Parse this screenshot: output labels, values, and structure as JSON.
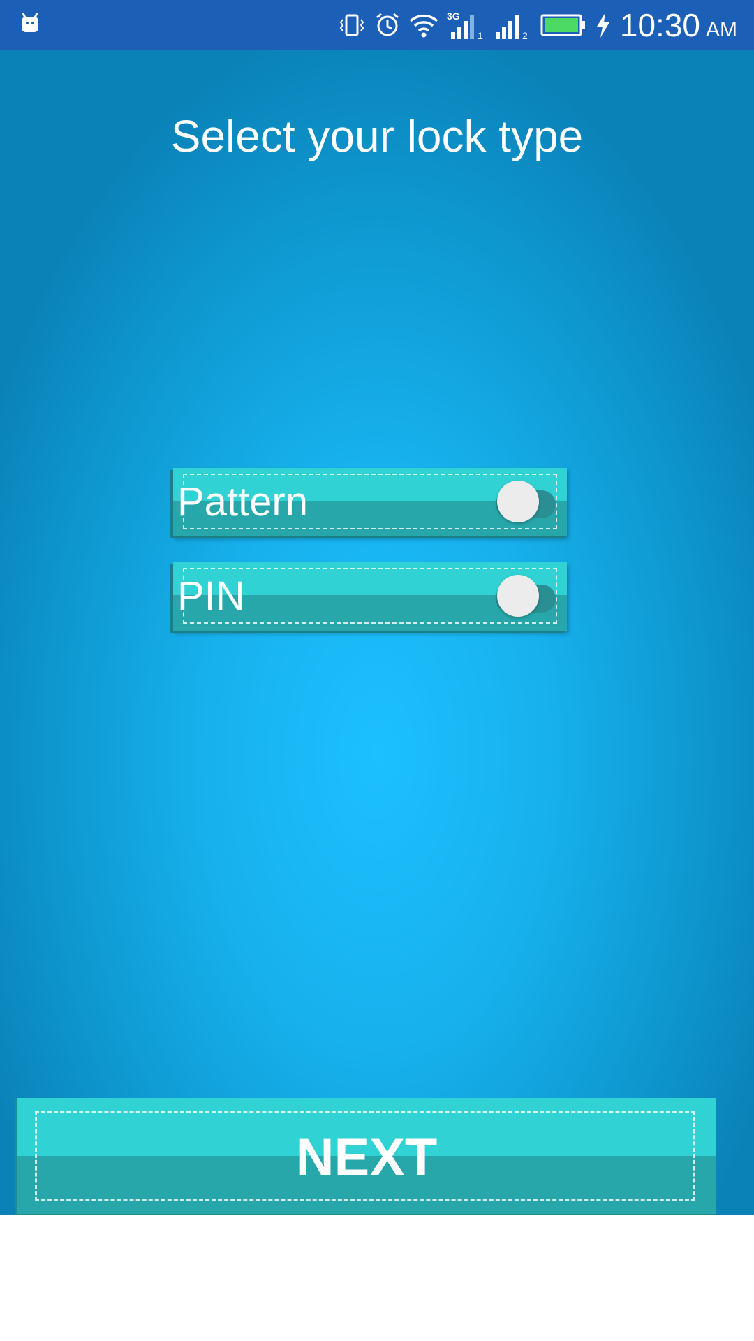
{
  "status_bar": {
    "time": "10:30",
    "ampm": "AM",
    "network_label": "3G",
    "sim1": "1",
    "sim2": "2",
    "icons": [
      "android-icon",
      "vibrate-icon",
      "alarm-icon",
      "wifi-icon",
      "signal-3g-icon",
      "signal-icon",
      "battery-icon",
      "charging-icon"
    ]
  },
  "page": {
    "title": "Select your lock type"
  },
  "options": [
    {
      "label": "Pattern",
      "enabled": false
    },
    {
      "label": "PIN",
      "enabled": false
    }
  ],
  "footer": {
    "next_label": "NEXT"
  },
  "colors": {
    "status_bar": "#1c5fb7",
    "background_center": "#1cc0ff",
    "background_edge": "#0a82b8",
    "button_top": "#31d2d4",
    "button_bottom": "#27a7a9",
    "toggle_thumb": "#ececec",
    "battery_fill": "#4cd964"
  }
}
